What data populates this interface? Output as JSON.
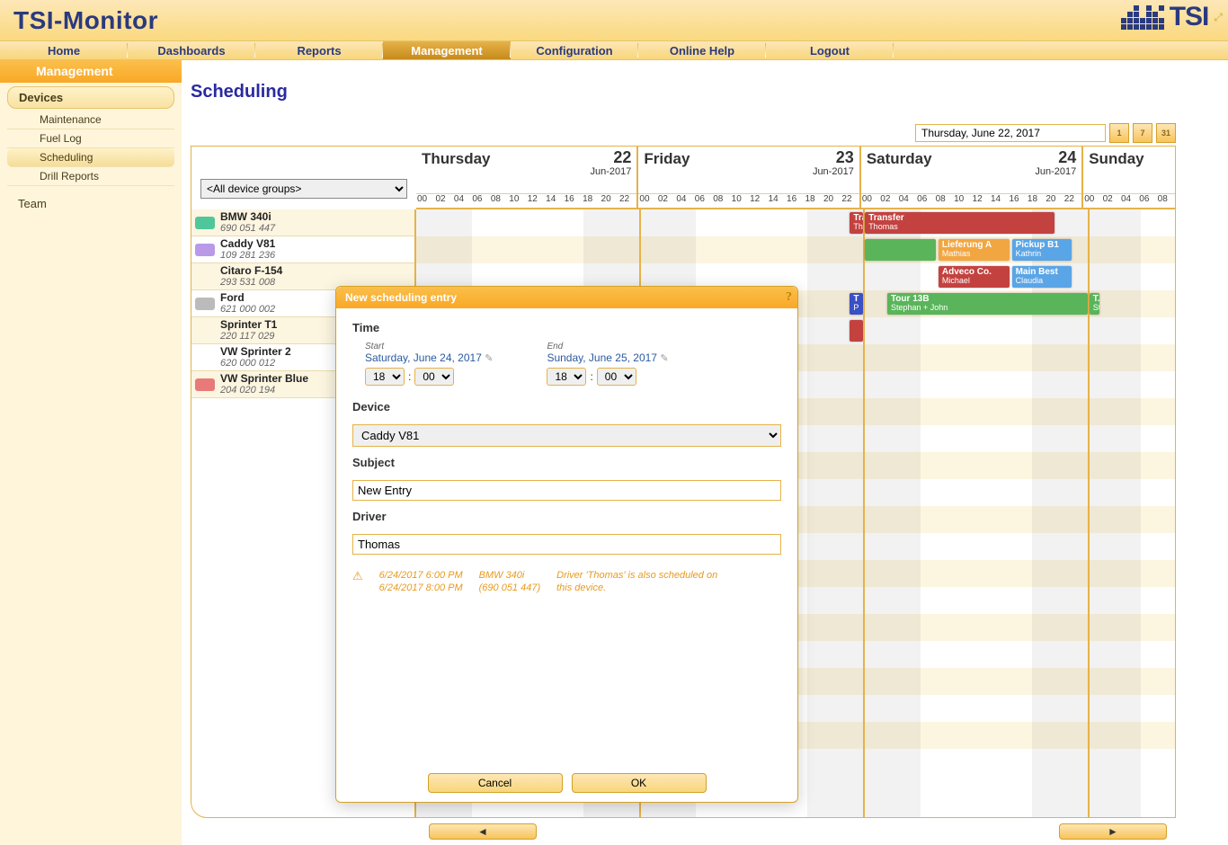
{
  "app_title": "TSI-Monitor",
  "tsi_label": "TSI",
  "nav": [
    "Home",
    "Dashboards",
    "Reports",
    "Management",
    "Configuration",
    "Online Help",
    "Logout"
  ],
  "nav_active": "Management",
  "section_title": "Management",
  "sidebar": {
    "group": "Devices",
    "subs": [
      "Maintenance",
      "Fuel Log",
      "Scheduling",
      "Drill Reports"
    ],
    "sub_active": "Scheduling",
    "item_team": "Team"
  },
  "page_heading": "Scheduling",
  "date_current": "Thursday, June 22, 2017",
  "view_labels": [
    "1",
    "7",
    "31"
  ],
  "filter_value": "<All device groups>",
  "days": [
    {
      "name": "Thursday",
      "num": "22",
      "month": "Jun-2017"
    },
    {
      "name": "Friday",
      "num": "23",
      "month": "Jun-2017"
    },
    {
      "name": "Saturday",
      "num": "24",
      "month": "Jun-2017"
    },
    {
      "name": "Sunday",
      "num": "",
      "month": ""
    }
  ],
  "hours": [
    "00",
    "02",
    "04",
    "06",
    "08",
    "10",
    "12",
    "14",
    "16",
    "18",
    "20",
    "22"
  ],
  "hours_sun": [
    "00",
    "02",
    "04",
    "06",
    "08"
  ],
  "devices": [
    {
      "name": "BMW 340i",
      "num": "690 051 447"
    },
    {
      "name": "Caddy V81",
      "num": "109 281 236"
    },
    {
      "name": "Citaro F-154",
      "num": "293 531 008"
    },
    {
      "name": "Ford",
      "num": "621 000 002"
    },
    {
      "name": "Sprinter T1",
      "num": "220 117 029"
    },
    {
      "name": "VW Sprinter 2",
      "num": "620 000 012"
    },
    {
      "name": "VW Sprinter Blue",
      "num": "204 020 194"
    }
  ],
  "events": {
    "trans1": {
      "title": "Trans...",
      "sub": "Thomas"
    },
    "transfer": {
      "title": "Transfer",
      "sub": "Thomas"
    },
    "liefA": {
      "title": "Lieferung A",
      "sub": "Mathias"
    },
    "pickup": {
      "title": "Pickup B1",
      "sub": "Kathrin"
    },
    "adveco": {
      "title": "Adveco Co.",
      "sub": "Michael"
    },
    "mainbest": {
      "title": "Main Best",
      "sub": "Claudia"
    },
    "t1": {
      "title": "T",
      "sub": "P"
    },
    "tour13": {
      "title": "Tour 13B",
      "sub": "Stephan + John"
    },
    "t2": {
      "title": "T...",
      "sub": "St..."
    }
  },
  "modal": {
    "title": "New scheduling entry",
    "help": "?",
    "time_label": "Time",
    "start_label": "Start",
    "end_label": "End",
    "start_date": "Saturday, June 24, 2017",
    "end_date": "Sunday, June 25, 2017",
    "hour_start": "18",
    "min_start": "00",
    "hour_end": "18",
    "min_end": "00",
    "colon": ":",
    "device_label": "Device",
    "device_value": "Caddy V81",
    "subject_label": "Subject",
    "subject_value": "New Entry",
    "driver_label": "Driver",
    "driver_value": "Thomas",
    "warn_time1": "6/24/2017 6:00 PM",
    "warn_time2": "6/24/2017 8:00 PM",
    "warn_dev": "BMW 340i",
    "warn_dev2": "(690 051 447)",
    "warn_msg": "Driver 'Thomas' is also scheduled on this device.",
    "cancel": "Cancel",
    "ok": "OK"
  },
  "scroll": {
    "left": "◄",
    "right": "►"
  }
}
